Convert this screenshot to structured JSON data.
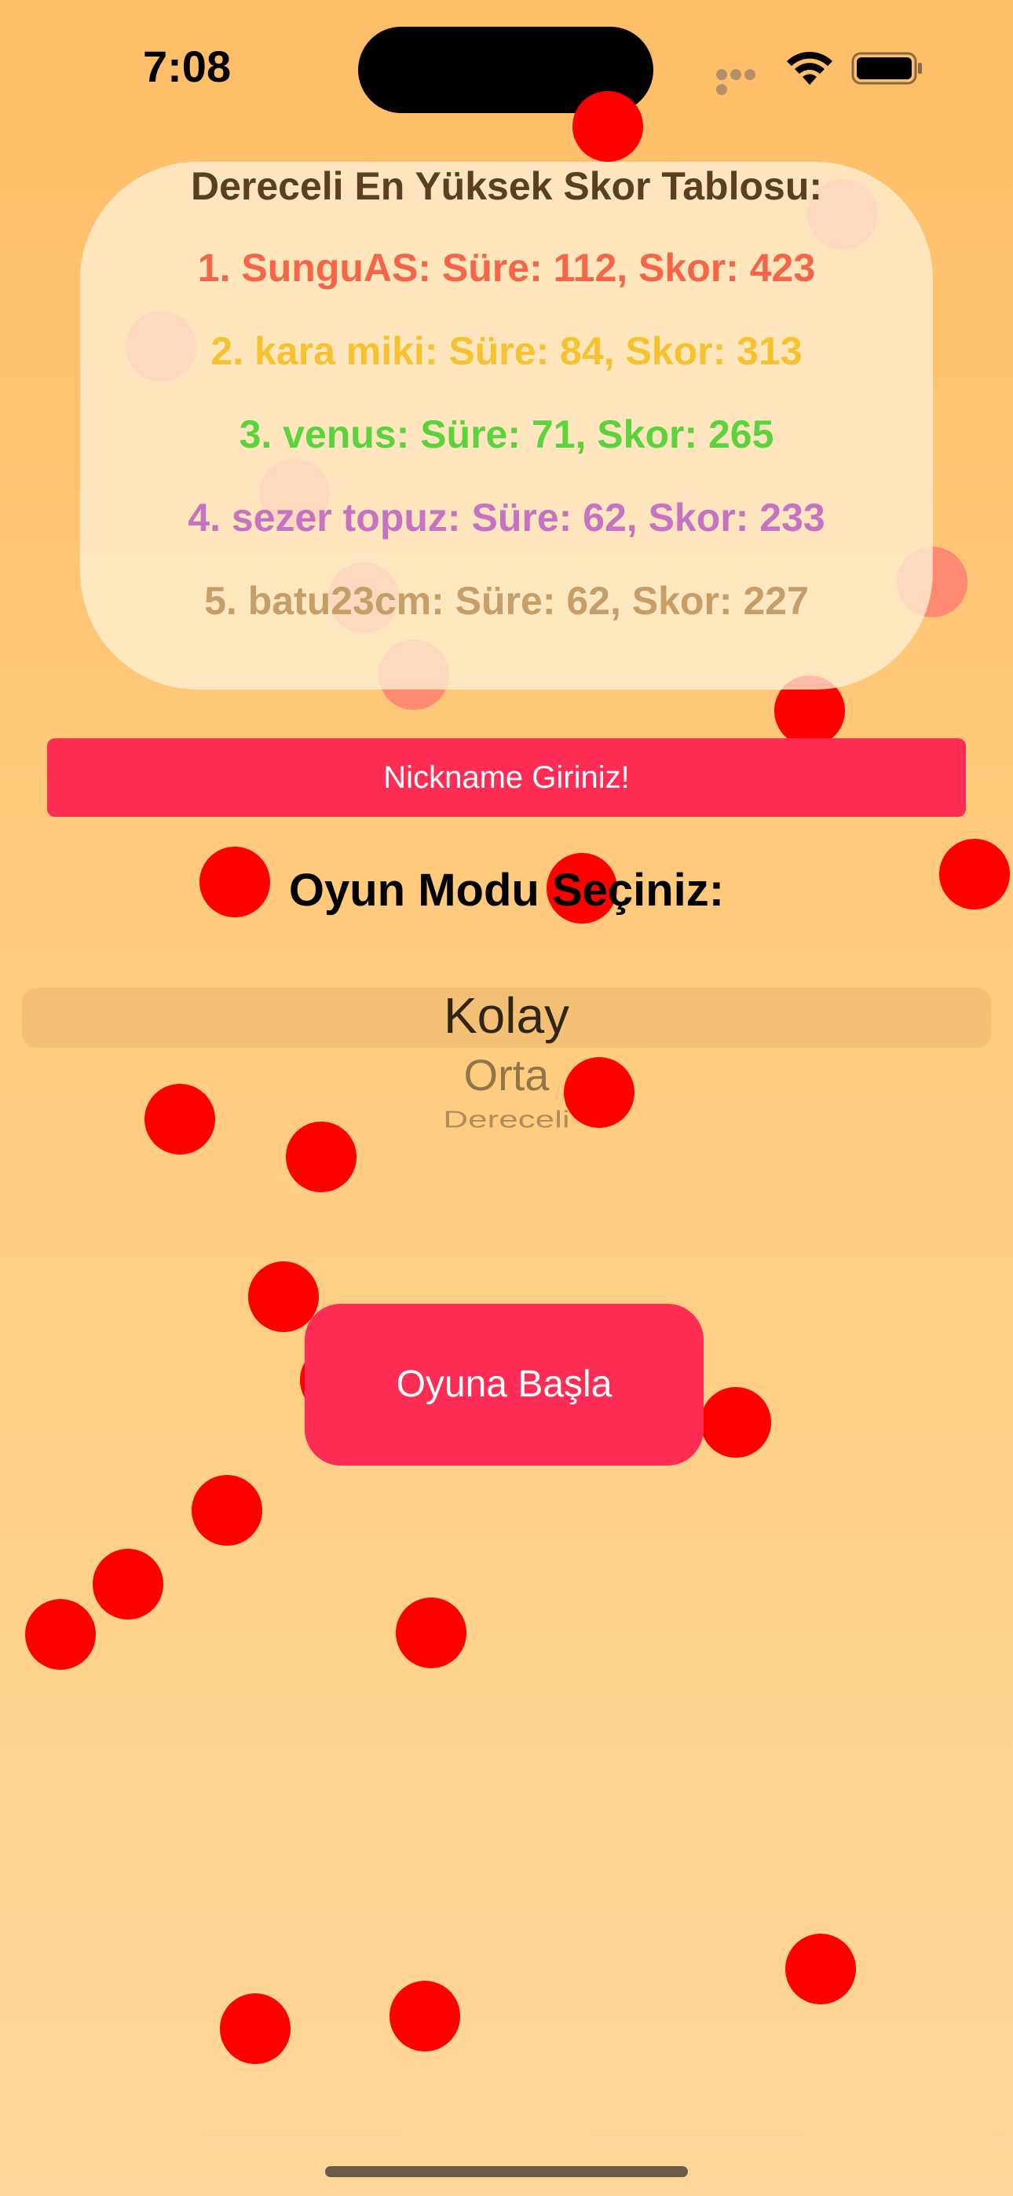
{
  "status_bar": {
    "time": "7:08"
  },
  "leaderboard": {
    "title": "Dereceli En Yüksek Skor Tablosu:",
    "entries": [
      {
        "text": "1. SunguAS: Süre: 112, Skor: 423",
        "color": "#f5654a"
      },
      {
        "text": "2. kara miki: Süre: 84, Skor: 313",
        "color": "#f7c22f"
      },
      {
        "text": "3. venus: Süre: 71, Skor: 265",
        "color": "#5cd23c"
      },
      {
        "text": "4. sezer topuz: Süre: 62, Skor: 233",
        "color": "#c674c2"
      },
      {
        "text": "5. batu23cm: Süre: 62, Skor: 227",
        "color": "#c79d68"
      }
    ]
  },
  "nickname_button": {
    "label": "Nickname Giriniz!"
  },
  "mode_section": {
    "title": "Oyun Modu Seçiniz:",
    "options": [
      "Kolay",
      "Orta",
      "Dereceli"
    ],
    "selected": "Kolay"
  },
  "start_button": {
    "label": "Oyuna Başla"
  },
  "colors": {
    "accent": "#ff2c55",
    "ball": "#ff0000"
  }
}
